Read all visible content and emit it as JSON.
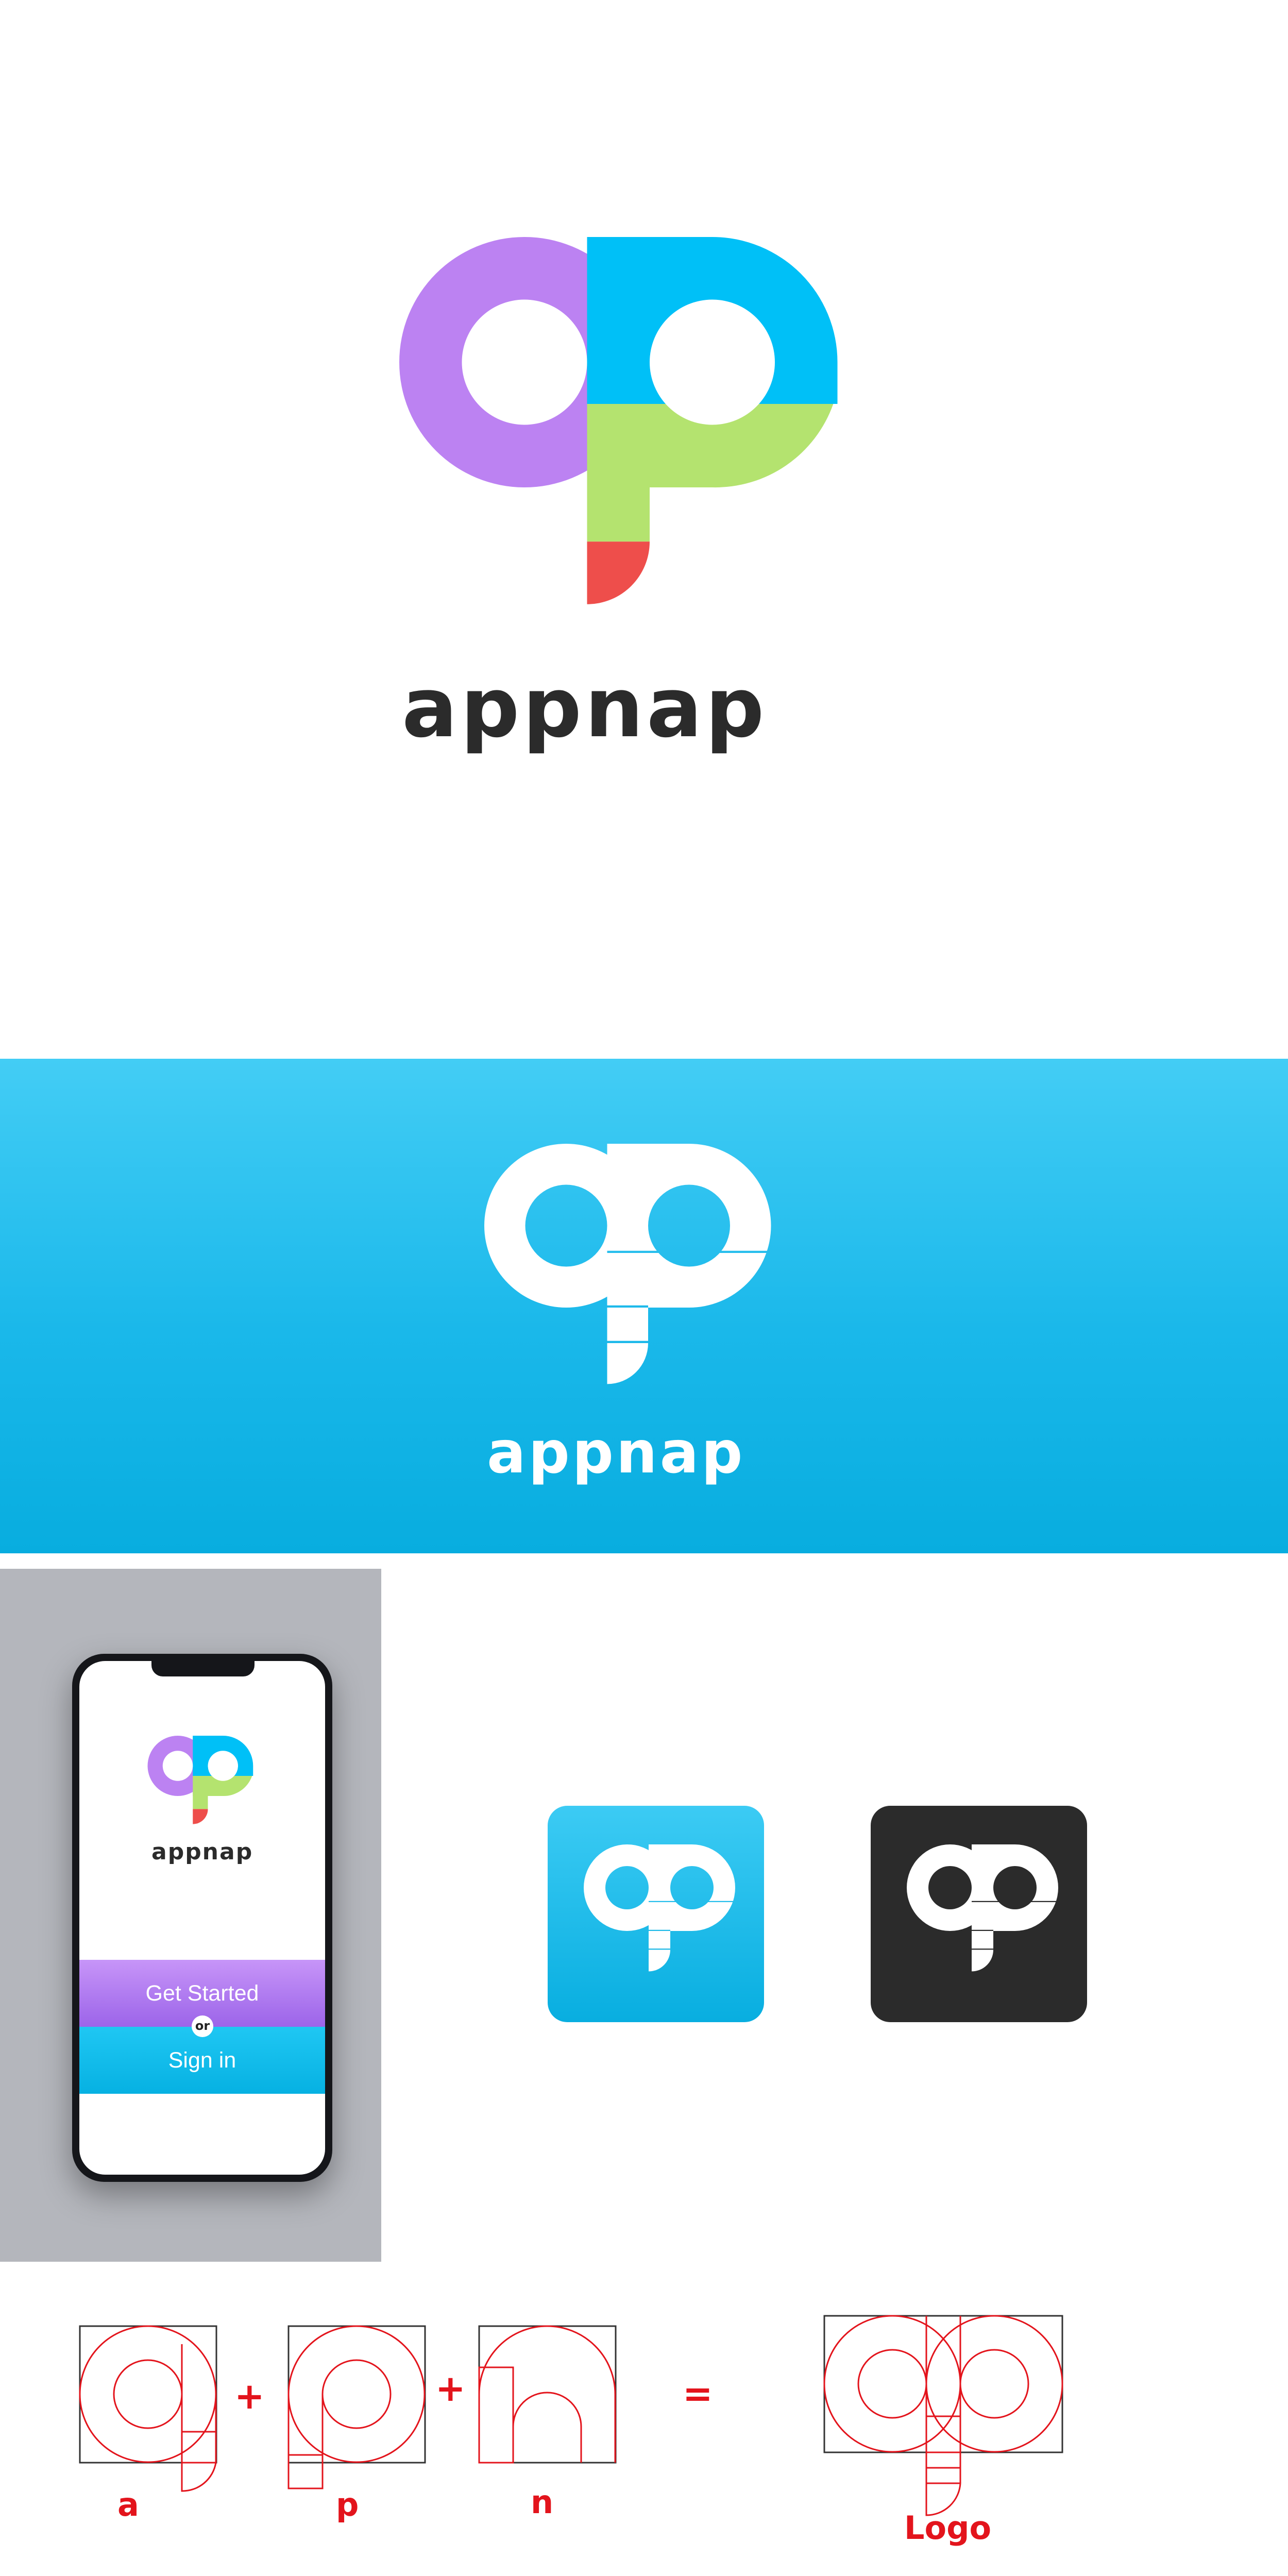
{
  "brand": {
    "name": "appnap",
    "colors": {
      "purple": "#bc82f2",
      "blue": "#00c0f7",
      "green": "#b4e36f",
      "red": "#ee4e4b",
      "dark": "#2b2b2b"
    }
  },
  "phone": {
    "get_started_label": "Get Started",
    "or_label": "or",
    "sign_in_label": "Sign in"
  },
  "construction": {
    "labels": [
      "a",
      "p",
      "n",
      "Logo"
    ],
    "operators": [
      "+",
      "+",
      "="
    ]
  }
}
